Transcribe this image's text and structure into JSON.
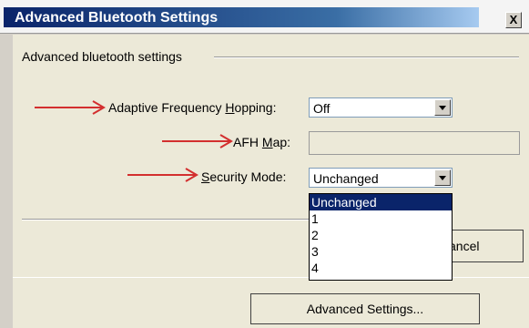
{
  "window": {
    "title": "Advanced Bluetooth Settings",
    "close_label": "X"
  },
  "group": {
    "label": "Advanced bluetooth settings"
  },
  "fields": {
    "afh": {
      "label_pre": "Adaptive Frequency ",
      "label_u": "H",
      "label_post": "opping:",
      "value": "Off"
    },
    "afh_map": {
      "label_pre": "AFH ",
      "label_u": "M",
      "label_post": "ap:"
    },
    "security": {
      "label_pre": "",
      "label_u": "S",
      "label_post": "ecurity Mode:",
      "value": "Unchanged"
    }
  },
  "dropdown": {
    "options": [
      "Unchanged",
      "1",
      "2",
      "3",
      "4"
    ],
    "selected": "Unchanged"
  },
  "buttons": {
    "cancel_label": "ancel",
    "advanced_label": "Advanced Settings..."
  },
  "colors": {
    "arrow": "#d32f2f",
    "selection": "#0a246a"
  }
}
